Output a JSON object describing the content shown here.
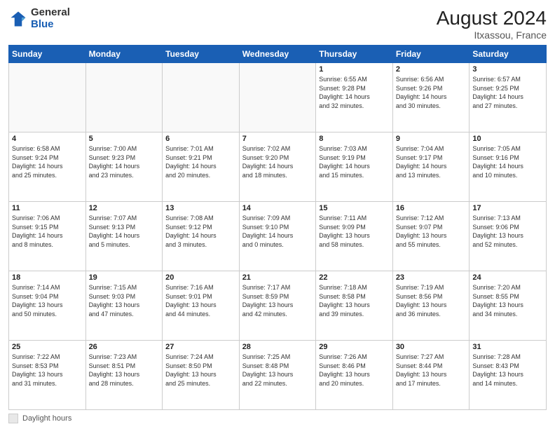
{
  "header": {
    "logo": {
      "general": "General",
      "blue": "Blue"
    },
    "title": "August 2024",
    "location": "Itxassou, France"
  },
  "calendar": {
    "days_of_week": [
      "Sunday",
      "Monday",
      "Tuesday",
      "Wednesday",
      "Thursday",
      "Friday",
      "Saturday"
    ],
    "weeks": [
      [
        {
          "day": "",
          "info": ""
        },
        {
          "day": "",
          "info": ""
        },
        {
          "day": "",
          "info": ""
        },
        {
          "day": "",
          "info": ""
        },
        {
          "day": "1",
          "info": "Sunrise: 6:55 AM\nSunset: 9:28 PM\nDaylight: 14 hours\nand 32 minutes."
        },
        {
          "day": "2",
          "info": "Sunrise: 6:56 AM\nSunset: 9:26 PM\nDaylight: 14 hours\nand 30 minutes."
        },
        {
          "day": "3",
          "info": "Sunrise: 6:57 AM\nSunset: 9:25 PM\nDaylight: 14 hours\nand 27 minutes."
        }
      ],
      [
        {
          "day": "4",
          "info": "Sunrise: 6:58 AM\nSunset: 9:24 PM\nDaylight: 14 hours\nand 25 minutes."
        },
        {
          "day": "5",
          "info": "Sunrise: 7:00 AM\nSunset: 9:23 PM\nDaylight: 14 hours\nand 23 minutes."
        },
        {
          "day": "6",
          "info": "Sunrise: 7:01 AM\nSunset: 9:21 PM\nDaylight: 14 hours\nand 20 minutes."
        },
        {
          "day": "7",
          "info": "Sunrise: 7:02 AM\nSunset: 9:20 PM\nDaylight: 14 hours\nand 18 minutes."
        },
        {
          "day": "8",
          "info": "Sunrise: 7:03 AM\nSunset: 9:19 PM\nDaylight: 14 hours\nand 15 minutes."
        },
        {
          "day": "9",
          "info": "Sunrise: 7:04 AM\nSunset: 9:17 PM\nDaylight: 14 hours\nand 13 minutes."
        },
        {
          "day": "10",
          "info": "Sunrise: 7:05 AM\nSunset: 9:16 PM\nDaylight: 14 hours\nand 10 minutes."
        }
      ],
      [
        {
          "day": "11",
          "info": "Sunrise: 7:06 AM\nSunset: 9:15 PM\nDaylight: 14 hours\nand 8 minutes."
        },
        {
          "day": "12",
          "info": "Sunrise: 7:07 AM\nSunset: 9:13 PM\nDaylight: 14 hours\nand 5 minutes."
        },
        {
          "day": "13",
          "info": "Sunrise: 7:08 AM\nSunset: 9:12 PM\nDaylight: 14 hours\nand 3 minutes."
        },
        {
          "day": "14",
          "info": "Sunrise: 7:09 AM\nSunset: 9:10 PM\nDaylight: 14 hours\nand 0 minutes."
        },
        {
          "day": "15",
          "info": "Sunrise: 7:11 AM\nSunset: 9:09 PM\nDaylight: 13 hours\nand 58 minutes."
        },
        {
          "day": "16",
          "info": "Sunrise: 7:12 AM\nSunset: 9:07 PM\nDaylight: 13 hours\nand 55 minutes."
        },
        {
          "day": "17",
          "info": "Sunrise: 7:13 AM\nSunset: 9:06 PM\nDaylight: 13 hours\nand 52 minutes."
        }
      ],
      [
        {
          "day": "18",
          "info": "Sunrise: 7:14 AM\nSunset: 9:04 PM\nDaylight: 13 hours\nand 50 minutes."
        },
        {
          "day": "19",
          "info": "Sunrise: 7:15 AM\nSunset: 9:03 PM\nDaylight: 13 hours\nand 47 minutes."
        },
        {
          "day": "20",
          "info": "Sunrise: 7:16 AM\nSunset: 9:01 PM\nDaylight: 13 hours\nand 44 minutes."
        },
        {
          "day": "21",
          "info": "Sunrise: 7:17 AM\nSunset: 8:59 PM\nDaylight: 13 hours\nand 42 minutes."
        },
        {
          "day": "22",
          "info": "Sunrise: 7:18 AM\nSunset: 8:58 PM\nDaylight: 13 hours\nand 39 minutes."
        },
        {
          "day": "23",
          "info": "Sunrise: 7:19 AM\nSunset: 8:56 PM\nDaylight: 13 hours\nand 36 minutes."
        },
        {
          "day": "24",
          "info": "Sunrise: 7:20 AM\nSunset: 8:55 PM\nDaylight: 13 hours\nand 34 minutes."
        }
      ],
      [
        {
          "day": "25",
          "info": "Sunrise: 7:22 AM\nSunset: 8:53 PM\nDaylight: 13 hours\nand 31 minutes."
        },
        {
          "day": "26",
          "info": "Sunrise: 7:23 AM\nSunset: 8:51 PM\nDaylight: 13 hours\nand 28 minutes."
        },
        {
          "day": "27",
          "info": "Sunrise: 7:24 AM\nSunset: 8:50 PM\nDaylight: 13 hours\nand 25 minutes."
        },
        {
          "day": "28",
          "info": "Sunrise: 7:25 AM\nSunset: 8:48 PM\nDaylight: 13 hours\nand 22 minutes."
        },
        {
          "day": "29",
          "info": "Sunrise: 7:26 AM\nSunset: 8:46 PM\nDaylight: 13 hours\nand 20 minutes."
        },
        {
          "day": "30",
          "info": "Sunrise: 7:27 AM\nSunset: 8:44 PM\nDaylight: 13 hours\nand 17 minutes."
        },
        {
          "day": "31",
          "info": "Sunrise: 7:28 AM\nSunset: 8:43 PM\nDaylight: 13 hours\nand 14 minutes."
        }
      ]
    ]
  },
  "footer": {
    "label": "Daylight hours"
  }
}
